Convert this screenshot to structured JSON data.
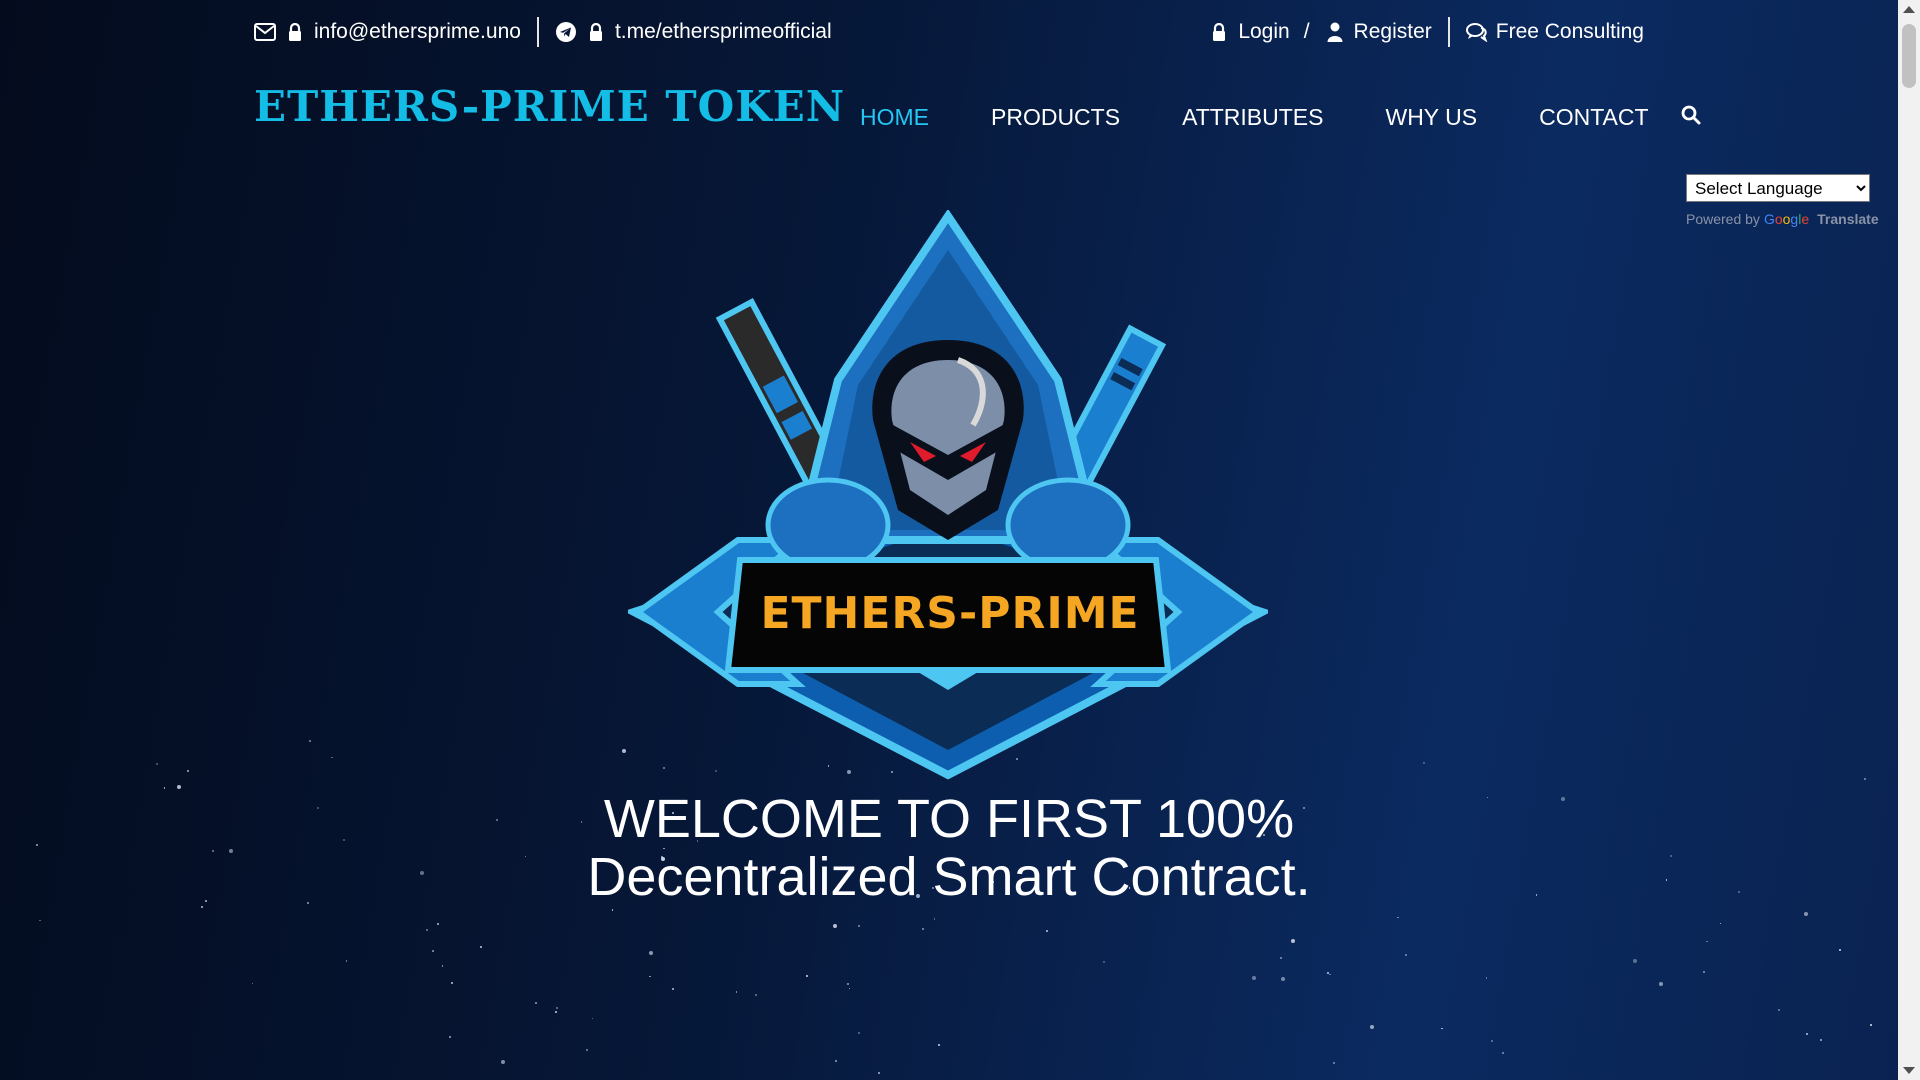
{
  "topbar": {
    "email": "info@ethersprime.uno",
    "telegram": "t.me/ethersprimeofficial",
    "login": "Login",
    "slash": "/",
    "register": "Register",
    "consulting": "Free Consulting"
  },
  "logo": {
    "text": "ETHERS-PRIME TOKEN"
  },
  "nav": {
    "items": [
      {
        "label": "HOME",
        "active": true
      },
      {
        "label": "PRODUCTS",
        "active": false
      },
      {
        "label": "ATTRIBUTES",
        "active": false
      },
      {
        "label": "WHY US",
        "active": false
      },
      {
        "label": "CONTACT",
        "active": false
      }
    ],
    "search_icon": "search-icon"
  },
  "translate": {
    "selected": "Select Language",
    "powered_by": "Powered by",
    "google": "Google",
    "translate": "Translate"
  },
  "hero": {
    "emblem_text": "ETHERS-PRIME",
    "title_line1": "WELCOME TO FIRST 100%",
    "title_line2": "Decentralized Smart Contract."
  },
  "colors": {
    "accent": "#25c6f2",
    "logo": "#13bde6",
    "emblem_gold": "#f5a623",
    "emblem_blue": "#1d6fbf"
  }
}
